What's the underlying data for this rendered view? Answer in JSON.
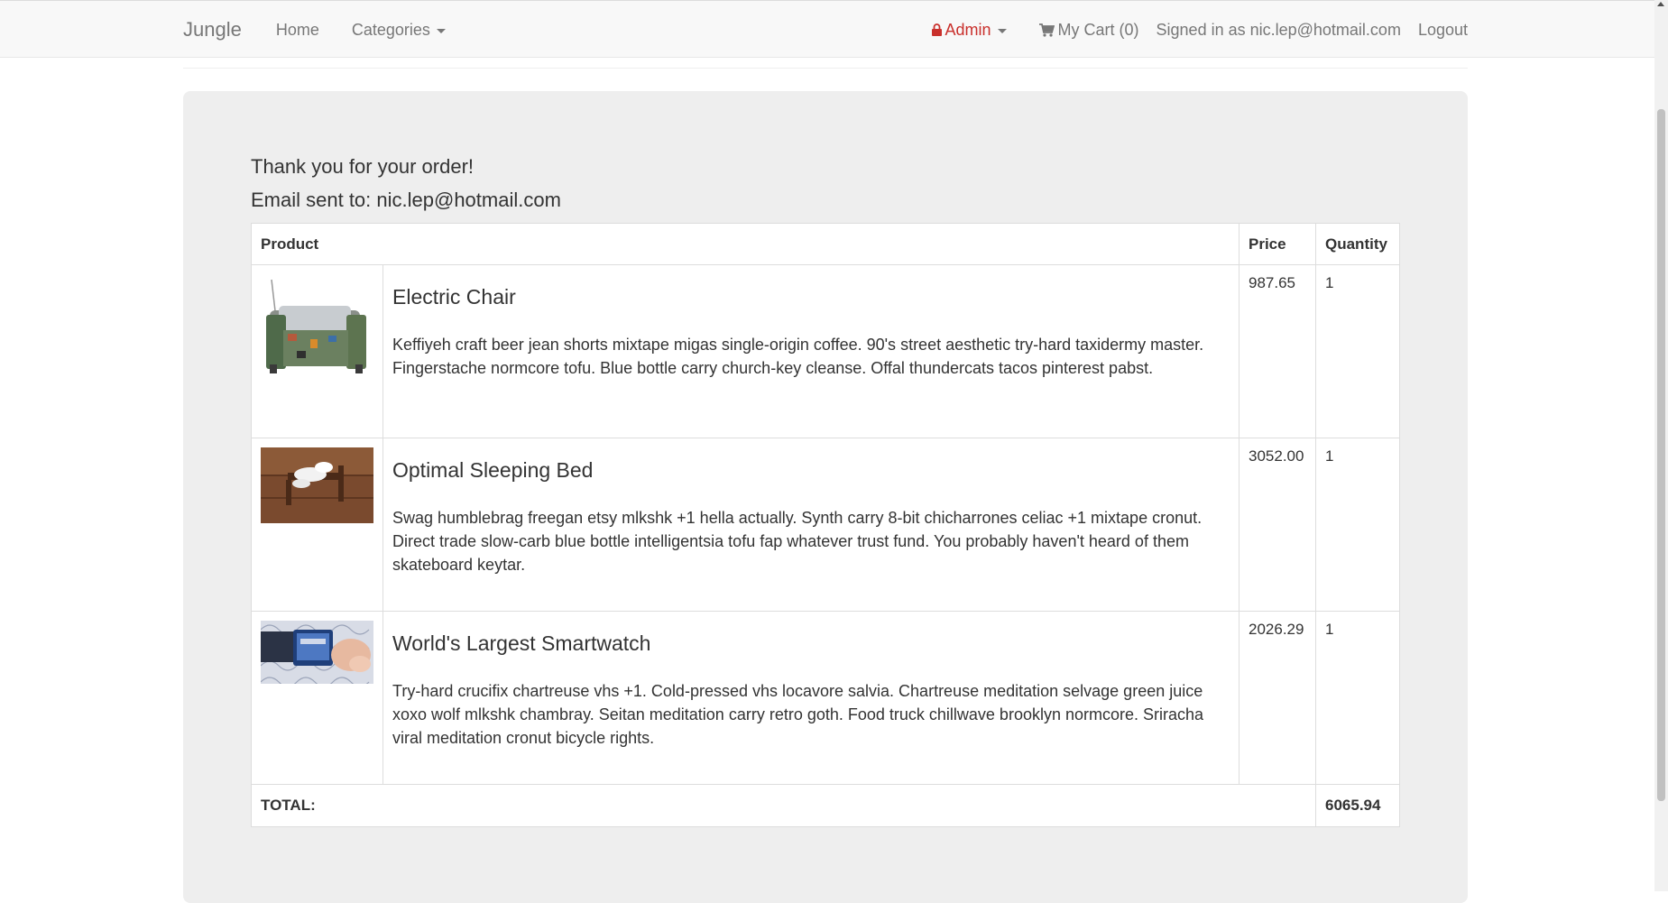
{
  "navbar": {
    "brand": "Jungle",
    "home": "Home",
    "categories": "Categories",
    "admin": "Admin",
    "cart": "My Cart (0)",
    "signed_in": "Signed in as nic.lep@hotmail.com",
    "logout": "Logout",
    "admin_color": "#c9302c"
  },
  "order": {
    "thank_you": "Thank you for your order!",
    "email_sent": "Email sent to: nic.lep@hotmail.com",
    "headers": {
      "product": "Product",
      "price": "Price",
      "quantity": "Quantity"
    },
    "items": [
      {
        "name": "Electric Chair",
        "description": "Keffiyeh craft beer jean shorts mixtape migas single-origin coffee. 90's street aesthetic try-hard taxidermy master. Fingerstache normcore tofu. Blue bottle carry church-key cleanse. Offal thundercats tacos pinterest pabst.",
        "price": "987.65",
        "quantity": "1"
      },
      {
        "name": "Optimal Sleeping Bed",
        "description": "Swag humblebrag freegan etsy mlkshk +1 hella actually. Synth carry 8-bit chicharrones celiac +1 mixtape cronut. Direct trade slow-carb blue bottle intelligentsia tofu fap whatever trust fund. You probably haven't heard of them skateboard keytar.",
        "price": "3052.00",
        "quantity": "1"
      },
      {
        "name": "World's Largest Smartwatch",
        "description": "Try-hard crucifix chartreuse vhs +1. Cold-pressed vhs locavore salvia. Chartreuse meditation selvage green juice xoxo wolf mlkshk chambray. Seitan meditation carry retro goth. Food truck chillwave brooklyn normcore. Sriracha viral meditation cronut bicycle rights.",
        "price": "2026.29",
        "quantity": "1"
      }
    ],
    "total_label": "TOTAL:",
    "total_value": "6065.94"
  }
}
